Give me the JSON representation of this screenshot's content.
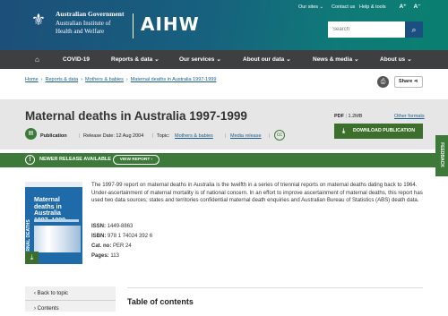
{
  "header": {
    "gov_line1": "Australian Government",
    "gov_line2": "Australian Institute of Health and Welfare",
    "logo_text": "AIHW",
    "top_links": [
      "Our sites ⌄",
      "Contact us",
      "Help & tools"
    ],
    "font_increase": "A⁺",
    "font_decrease": "A⁻",
    "search_placeholder": "Search"
  },
  "nav": {
    "home_icon": "home-icon",
    "items": [
      "COVID-19",
      "Reports & data",
      "Our services",
      "About our data",
      "News & media",
      "About us"
    ]
  },
  "breadcrumb": [
    "Home",
    "Reports & data",
    "Mothers & babies",
    "Maternal deaths in Australia 1997-1999"
  ],
  "actions": {
    "print_icon": "print-icon",
    "share_label": "Share"
  },
  "report": {
    "title": "Maternal deaths in Australia 1997-1999",
    "type": "Publication",
    "release_date": "Release Date: 12 Aug 2004",
    "topic_label": "Topic:",
    "topic": "Mothers & babies",
    "media": "Media release",
    "pdf_label": "PDF",
    "pdf_size": "1.2MB",
    "other_formats": "Other formats",
    "download_label": "DOWNLOAD PUBLICATION"
  },
  "release_banner": {
    "text": "NEWER RELEASE AVAILABLE",
    "button": "VIEW REPORT"
  },
  "feedback_label": "FEEDBACK",
  "cover": {
    "title": "Maternal deaths in Australia 1997–1999",
    "side_text": "ERNAL DEATHS"
  },
  "description": "The 1997-99 report on maternal deaths in Australia is the twelfth in a series of triennial reports on maternal deaths dating back to 1964. Under-ascertainment of maternal mortality is of national concern. In an effort to improve ascertainment of maternal deaths, this report has used two data sources; states and territories confidential maternal death enquiries and Australian Bureau of Statistics (ABS) death data.",
  "facts": [
    {
      "label": "ISSN:",
      "value": "1449-8863"
    },
    {
      "label": "ISBN:",
      "value": "978 1 74024 392 6"
    },
    {
      "label": "Cat. no:",
      "value": "PER 24"
    },
    {
      "label": "Pages:",
      "value": "113"
    }
  ],
  "sidenav": {
    "back": "Back to topic",
    "contents": "Contents"
  },
  "toc_title": "Table of contents"
}
